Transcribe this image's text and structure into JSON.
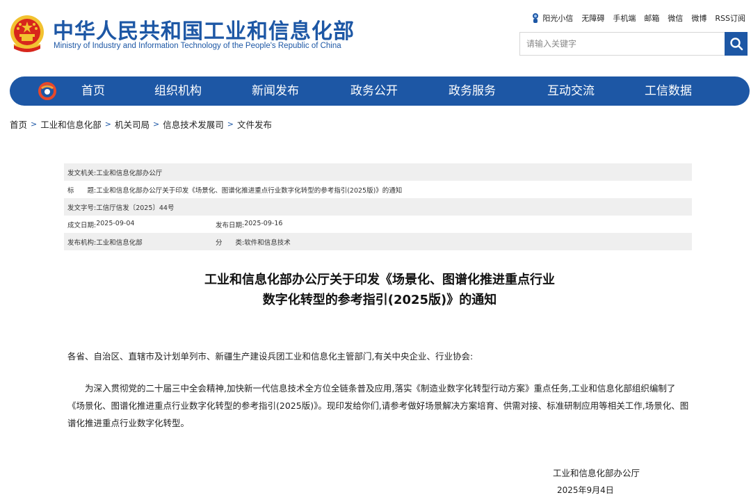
{
  "header": {
    "logo_cn": "中华人民共和国工业和信息化部",
    "logo_en": "Ministry of Industry and Information Technology of the People's Republic of China",
    "top_links": [
      "阳光小信",
      "无障碍",
      "手机端",
      "邮箱",
      "微信",
      "微博",
      "RSS订阅"
    ],
    "search_placeholder": "请输入关键字"
  },
  "nav": {
    "items": [
      "首页",
      "组织机构",
      "新闻发布",
      "政务公开",
      "政务服务",
      "互动交流",
      "工信数据"
    ]
  },
  "breadcrumb": [
    "首页",
    "工业和信息化部",
    "机关司局",
    "信息技术发展司",
    "文件发布"
  ],
  "info": {
    "issuer_label": "发文机关:",
    "issuer": "工业和信息化部办公厅",
    "title_label": "标　　题:",
    "title": "工业和信息化部办公厅关于印发《场景化、图谱化推进重点行业数字化转型的参考指引(2025版)》的通知",
    "doc_no_label": "发文字号:",
    "doc_no": "工信厅信发〔2025〕44号",
    "written_label": "成文日期:",
    "written": "2025-09-04",
    "published_label": "发布日期:",
    "published": "2025-09-16",
    "org_label": "发布机构:",
    "org": "工业和信息化部",
    "category_label": "分　　类:",
    "category": "软件和信息技术"
  },
  "doc": {
    "title_line1": "工业和信息化部办公厅关于印发《场景化、图谱化推进重点行业",
    "title_line2": "数字化转型的参考指引(2025版)》的通知",
    "salutation": "各省、自治区、直辖市及计划单列市、新疆生产建设兵团工业和信息化主管部门,有关中央企业、行业协会:",
    "paragraph": "为深入贯彻党的二十届三中全会精神,加快新一代信息技术全方位全链条普及应用,落实《制造业数字化转型行动方案》重点任务,工业和信息化部组织编制了《场景化、图谱化推进重点行业数字化转型的参考指引(2025版)》。现印发给你们,请参考做好场景解决方案培育、供需对接、标准研制应用等相关工作,场景化、图谱化推进重点行业数字化转型。",
    "signer": "工业和信息化部办公厅",
    "sign_date": "2025年9月4日"
  },
  "colors": {
    "brand": "#1d57a5",
    "emblem_red": "#d7261c",
    "emblem_gold": "#f2c230",
    "row_shade": "#efefef"
  }
}
